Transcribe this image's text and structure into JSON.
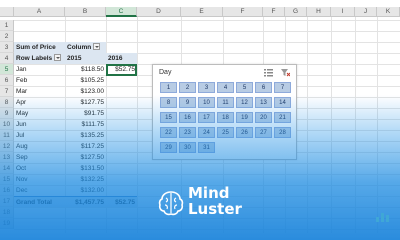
{
  "columns": [
    "A",
    "B",
    "C",
    "D",
    "E",
    "F",
    "G",
    "H",
    "I",
    "J",
    "K"
  ],
  "rows": [
    "1",
    "2",
    "3",
    "4",
    "5",
    "6",
    "7",
    "8",
    "9",
    "10",
    "11",
    "12",
    "13",
    "14",
    "15",
    "16",
    "17",
    "18",
    "19"
  ],
  "pivot": {
    "title": "Sum of Price",
    "column_label": "Column",
    "row_labels": "Row Labels",
    "years": [
      "2015",
      "2016"
    ],
    "data": [
      {
        "month": "Jan",
        "v2015": "$118.50",
        "v2016": "$52.75"
      },
      {
        "month": "Feb",
        "v2015": "$105.25",
        "v2016": ""
      },
      {
        "month": "Mar",
        "v2015": "$123.00",
        "v2016": ""
      },
      {
        "month": "Apr",
        "v2015": "$127.75",
        "v2016": ""
      },
      {
        "month": "May",
        "v2015": "$91.75",
        "v2016": ""
      },
      {
        "month": "Jun",
        "v2015": "$111.75",
        "v2016": ""
      },
      {
        "month": "Jul",
        "v2015": "$135.25",
        "v2016": ""
      },
      {
        "month": "Aug",
        "v2015": "$117.25",
        "v2016": ""
      },
      {
        "month": "Sep",
        "v2015": "$127.50",
        "v2016": ""
      },
      {
        "month": "Oct",
        "v2015": "$131.50",
        "v2016": ""
      },
      {
        "month": "Nov",
        "v2015": "$132.25",
        "v2016": ""
      },
      {
        "month": "Dec",
        "v2015": "$132.00",
        "v2016": ""
      }
    ],
    "grand_total_label": "Grand Total",
    "grand_2015": "$1,457.75",
    "grand_2016": "$52.75"
  },
  "slicer": {
    "title": "Day",
    "days": [
      "1",
      "2",
      "3",
      "4",
      "5",
      "6",
      "7",
      "8",
      "9",
      "10",
      "11",
      "12",
      "13",
      "14",
      "15",
      "16",
      "17",
      "18",
      "19",
      "20",
      "21",
      "22",
      "23",
      "24",
      "25",
      "26",
      "27",
      "28",
      "29",
      "30",
      "31"
    ]
  },
  "watermark": {
    "line1": "Mind",
    "line2": "Luster"
  },
  "colors": {
    "excel_green": "#217346",
    "slicer_item": "#b8cce4",
    "overlay_blue": "#1e8ce1",
    "pivot_header": "#dce6f1"
  }
}
